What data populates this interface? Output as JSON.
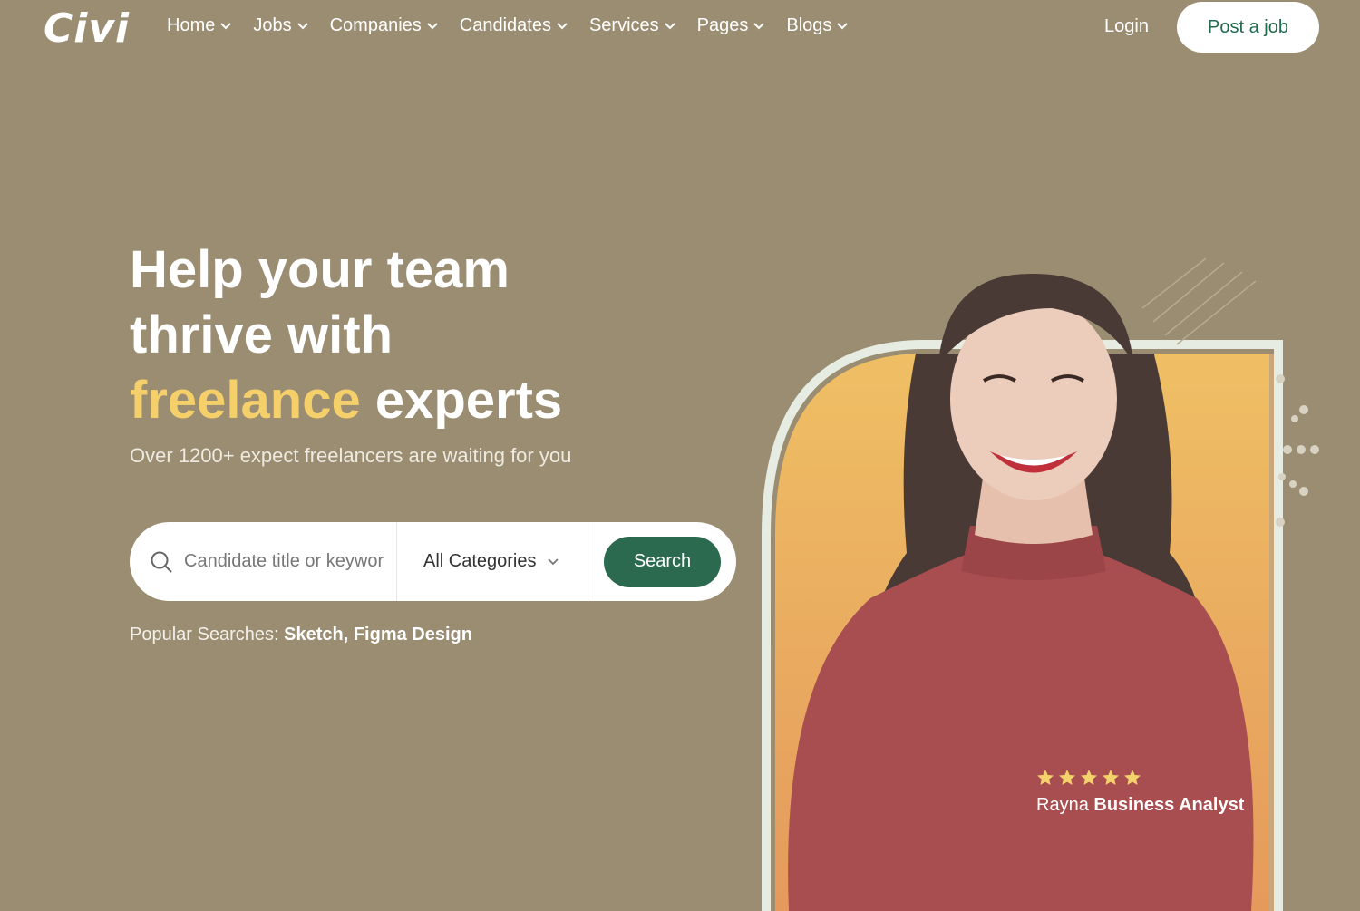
{
  "brand": {
    "logo_text": "Civi"
  },
  "nav": {
    "items": [
      {
        "label": "Home"
      },
      {
        "label": "Jobs"
      },
      {
        "label": "Companies"
      },
      {
        "label": "Candidates"
      },
      {
        "label": "Services"
      },
      {
        "label": "Pages"
      },
      {
        "label": "Blogs"
      }
    ],
    "login_label": "Login",
    "post_job_label": "Post a job"
  },
  "hero": {
    "headline_line1": "Help your team",
    "headline_line2": "thrive with",
    "headline_accent": "freelance",
    "headline_rest": "experts",
    "subtitle": "Over 1200+ expect freelancers are waiting for you"
  },
  "search": {
    "placeholder": "Candidate title or keyword",
    "category_value": "All Categories",
    "button_label": "Search"
  },
  "popular": {
    "label": "Popular Searches:",
    "tags": [
      "Sketch,",
      "Figma Design"
    ]
  },
  "testimonial": {
    "stars": 5,
    "name": "Rayna",
    "role": "Business Analyst"
  },
  "colors": {
    "background": "#9a8d72",
    "accent_yellow": "#f5cf6a",
    "brand_green": "#2c6a50",
    "star": "#f5d36b"
  }
}
